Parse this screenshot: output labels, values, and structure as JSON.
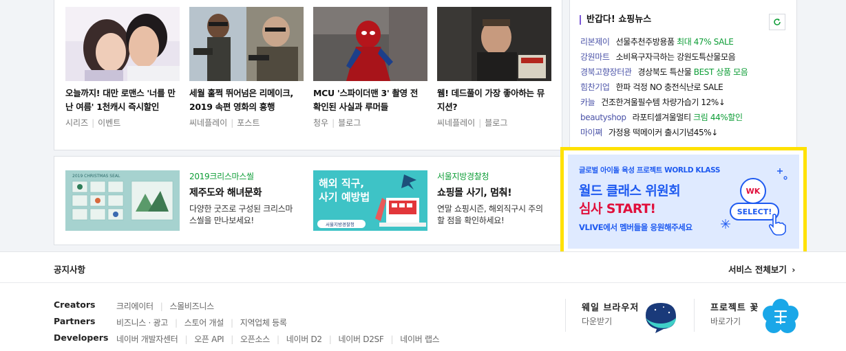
{
  "videos": [
    {
      "title": "오늘까지! 대만 로맨스 '너를 만난 여름' 1천캐시 즉시할인",
      "source": "시리즈",
      "type": "이벤트"
    },
    {
      "title": "세월 훌쩍 뛰어넘은 리메이크, 2019 속편 영화의 흥행",
      "source": "씨네플레이",
      "type": "포스트"
    },
    {
      "title": "MCU '스파이더맨 3' 촬영 전 확인된 사실과 루머들",
      "source": "청우",
      "type": "블로그"
    },
    {
      "title": "웸! 데드풀이 가장 좋아하는 뮤지션?",
      "source": "씨네플레이",
      "type": "블로그"
    }
  ],
  "promos": [
    {
      "category": "2019크리스마스씰",
      "title": "제주도와 해녀문화",
      "desc": "다양한 굿즈로 구성된 크리스마스씰을 만나보세요!",
      "thumb_caption": "2019 CHRISTMAS SEAL"
    },
    {
      "category": "서울지방경찰청",
      "title": "쇼핑몰 사기, 멈춰!",
      "desc": "연말 쇼핑시즌, 해외직구시 주의할 점을 확인하세요!",
      "thumb_line1": "해외 직구,",
      "thumb_line2": "사기 예방법",
      "thumb_logo": "서울지방경찰청"
    }
  ],
  "shopping_news": {
    "title": "반갑다! 쇼핑뉴스",
    "items": [
      {
        "shop": "리본제이",
        "text": "선물추천주방용품 ",
        "highlight": "최대 47% SALE",
        "after": ""
      },
      {
        "shop": "강원마트",
        "text": "소비욕구자극하는 강원도특산물모음",
        "highlight": "",
        "after": ""
      },
      {
        "shop": "경북고향장터관",
        "text": "경상북도 특산물 ",
        "highlight": "BEST 상품 모음",
        "after": ""
      },
      {
        "shop": "힘찬기업",
        "text": "한파 걱정 NO 충전식난로 SALE",
        "highlight": "",
        "after": ""
      },
      {
        "shop": "카늘",
        "text": "건조한겨울필수템 차량가습기 12%↓",
        "highlight": "",
        "after": ""
      },
      {
        "shop": "beautyshop",
        "text": "라포티셀겨울멀티 ",
        "highlight": "크림 44%할인",
        "after": ""
      },
      {
        "shop": "마이쪄",
        "text": "가정용 떡메이커 출시기념45%↓",
        "highlight": "",
        "after": ""
      }
    ]
  },
  "ad": {
    "top_line": "글로벌 아이돌 육성 프로젝트 WORLD KLASS",
    "headline1": "월드 클래스 위원회",
    "headline2": "심사 START!",
    "bottom_line": "VLIVE에서 멤버들을 응원해주세요",
    "badge": "WK",
    "select_label": "SELECT!"
  },
  "footer": {
    "notice": "공지사항",
    "all_services": "서비스 전체보기",
    "rows": [
      {
        "label": "Creators",
        "links": [
          "크리에이터",
          "스몰비즈니스"
        ]
      },
      {
        "label": "Partners",
        "links": [
          "비즈니스 · 광고",
          "스토어 개설",
          "지역업체 등록"
        ]
      },
      {
        "label": "Developers",
        "links": [
          "네이버 개발자센터",
          "오픈 API",
          "오픈소스",
          "네이버 D2",
          "네이버 D2SF",
          "네이버 랩스"
        ]
      }
    ],
    "apps": [
      {
        "title": "웨일 브라우저",
        "sub": "다운받기"
      },
      {
        "title": "프로젝트 꽃",
        "sub": "바로가기"
      }
    ]
  },
  "colors": {
    "accent_green": "#0d9d36",
    "shop_purple": "#4b53a8",
    "ad_border": "#ffe100",
    "ad_text": "#1e5af0",
    "ad_red": "#e0103c"
  }
}
